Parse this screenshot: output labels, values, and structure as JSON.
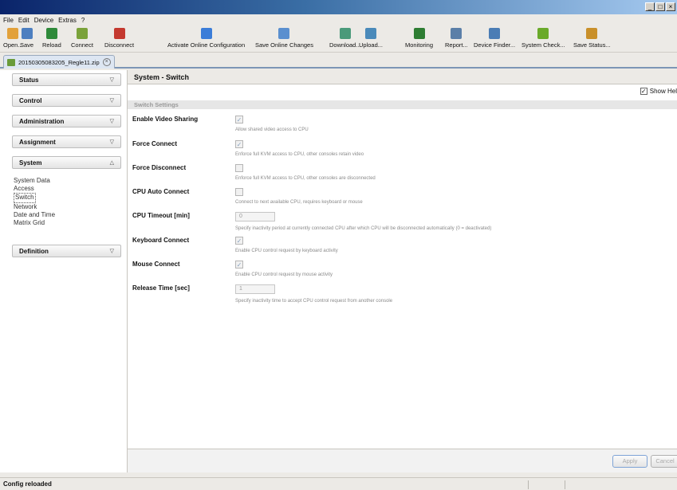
{
  "menu": [
    "File",
    "Edit",
    "Device",
    "Extras",
    "?"
  ],
  "toolbar": [
    {
      "label": "Open...",
      "icon": "folder-icon",
      "color": "#e2a13a"
    },
    {
      "label": "Save",
      "icon": "save-icon",
      "color": "#4d7fc0"
    },
    {
      "label": "Reload",
      "icon": "reload-icon",
      "color": "#2f8a3a"
    },
    {
      "label": "Connect",
      "icon": "connect-icon",
      "color": "#7aa23a"
    },
    {
      "label": "Disconnect",
      "icon": "disconnect-icon",
      "color": "#c4392f"
    },
    {
      "label": "Activate Online Configuration",
      "icon": "activate-config-icon",
      "color": "#3b7dd8"
    },
    {
      "label": "Save Online Changes",
      "icon": "save-online-icon",
      "color": "#5a8fcf"
    },
    {
      "label": "Download...",
      "icon": "download-icon",
      "color": "#4a9a7a"
    },
    {
      "label": "Upload...",
      "icon": "upload-icon",
      "color": "#4a8aba"
    },
    {
      "label": "Monitoring",
      "icon": "monitoring-icon",
      "color": "#2e7d32"
    },
    {
      "label": "Report...",
      "icon": "report-icon",
      "color": "#5b7fa8"
    },
    {
      "label": "Device Finder...",
      "icon": "device-finder-icon",
      "color": "#4b7db5"
    },
    {
      "label": "System Check...",
      "icon": "check-icon",
      "color": "#6aaa2a"
    },
    {
      "label": "Save Status...",
      "icon": "save-status-icon",
      "color": "#c9902a"
    }
  ],
  "tab": {
    "label": "20150305083205_Regle11.zip"
  },
  "sidebar": {
    "sections": [
      {
        "label": "Status",
        "state": "collapsed"
      },
      {
        "label": "Control",
        "state": "collapsed"
      },
      {
        "label": "Administration",
        "state": "collapsed"
      },
      {
        "label": "Assignment",
        "state": "collapsed"
      },
      {
        "label": "System",
        "state": "expanded"
      },
      {
        "label": "Definition",
        "state": "collapsed"
      }
    ],
    "system_items": [
      "System Data",
      "Access",
      "Switch",
      "Network",
      "Date and Time",
      "Matrix Grid"
    ],
    "selected": "Switch"
  },
  "main": {
    "title": "System - Switch",
    "show_help_label": "Show Hel",
    "show_help_checked": true,
    "section_title": "Switch Settings",
    "rows": [
      {
        "label": "Enable Video Sharing",
        "control": "checkbox",
        "checked": true,
        "hint": "Allow shared video access to CPU"
      },
      {
        "label": "Force Connect",
        "control": "checkbox",
        "checked": true,
        "hint": "Enforce full KVM access to CPU, other consoles retain video"
      },
      {
        "label": "Force Disconnect",
        "control": "checkbox",
        "checked": false,
        "hint": "Enforce full KVM access to CPU, other consoles are disconnected"
      },
      {
        "label": "CPU Auto Connect",
        "control": "checkbox",
        "checked": false,
        "hint": "Connect to next available CPU, requires keyboard or mouse"
      },
      {
        "label": "CPU Timeout [min]",
        "control": "number",
        "value": "0",
        "hint": "Specify inactivity period at currently connected CPU after which CPU will be disconnected automatically (0 = deactivated)"
      },
      {
        "label": "Keyboard Connect",
        "control": "checkbox",
        "checked": true,
        "hint": "Enable CPU control request by keyboard activity"
      },
      {
        "label": "Mouse Connect",
        "control": "checkbox",
        "checked": true,
        "hint": "Enable CPU control request by mouse activity"
      },
      {
        "label": "Release Time [sec]",
        "control": "number",
        "value": "1",
        "hint": "Specify inactivity time to accept CPU control request from another console"
      }
    ],
    "apply_label": "Apply",
    "cancel_label": "Cancel"
  },
  "status": {
    "message": "Config reloaded"
  }
}
